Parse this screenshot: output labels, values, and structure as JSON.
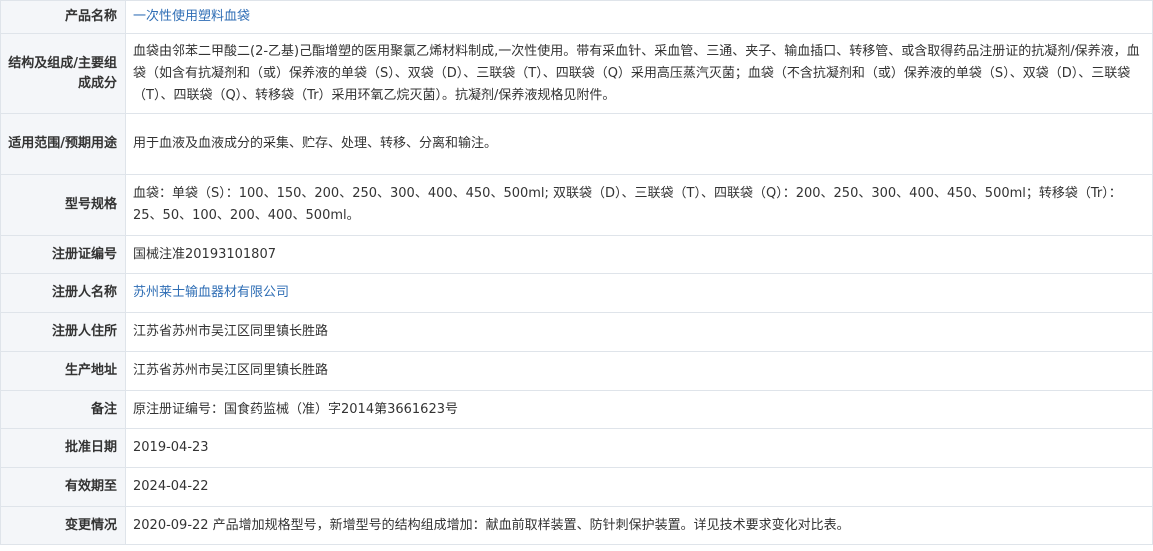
{
  "rows": [
    {
      "label": "产品名称",
      "value": "一次性使用塑料血袋",
      "link": true
    },
    {
      "label": "结构及组成/主要组成成分",
      "value": "血袋由邻苯二甲酸二(2-乙基)己酯增塑的医用聚氯乙烯材料制成,一次性使用。带有采血针、采血管、三通、夹子、输血插口、转移管、或含取得药品注册证的抗凝剂/保养液，血袋（如含有抗凝剂和（或）保养液的单袋（S）、双袋（D）、三联袋（T）、四联袋（Q）采用高压蒸汽灭菌；血袋（不含抗凝剂和（或）保养液的单袋（S）、双袋（D）、三联袋（T）、四联袋（Q）、转移袋（Tr）采用环氧乙烷灭菌）。抗凝剂/保养液规格见附件。",
      "link": false
    },
    {
      "label": "适用范围/预期用途",
      "value": "用于血液及血液成分的采集、贮存、处理、转移、分离和输注。",
      "link": false
    },
    {
      "label": "型号规格",
      "value": "血袋：单袋（S）：100、150、200、250、300、400、450、500ml; 双联袋（D）、三联袋（T）、四联袋（Q）：200、250、300、400、450、500ml；转移袋（Tr）：25、50、100、200、400、500ml。",
      "link": false
    },
    {
      "label": "注册证编号",
      "value": "国械注准20193101807",
      "link": false
    },
    {
      "label": "注册人名称",
      "value": "苏州莱士输血器材有限公司",
      "link": true
    },
    {
      "label": "注册人住所",
      "value": "江苏省苏州市吴江区同里镇长胜路",
      "link": false
    },
    {
      "label": "生产地址",
      "value": "江苏省苏州市吴江区同里镇长胜路",
      "link": false
    },
    {
      "label": "备注",
      "value": "原注册证编号：国食药监械（准）字2014第3661623号",
      "link": false
    },
    {
      "label": "批准日期",
      "value": "2019-04-23",
      "link": false
    },
    {
      "label": "有效期至",
      "value": "2024-04-22",
      "link": false
    },
    {
      "label": "变更情况",
      "value": "2020-09-22 产品增加规格型号，新增型号的结构组成增加：献血前取样装置、防针刺保护装置。详见技术要求变化对比表。",
      "link": false
    }
  ],
  "colors": {
    "label_bg": "#f4f6f9",
    "border": "#dfe4ea",
    "link": "#2f6eb5",
    "text": "#333333"
  }
}
